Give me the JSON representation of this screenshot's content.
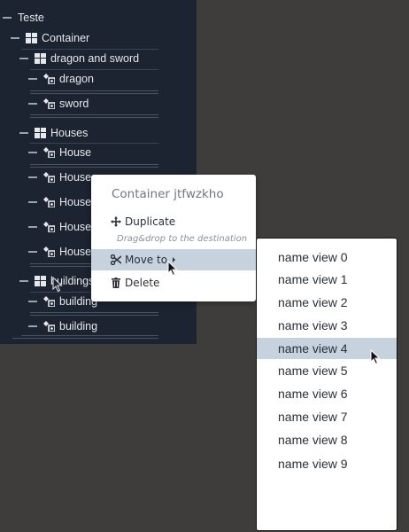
{
  "tree": {
    "nodes": [
      {
        "label": "Teste",
        "icon": "none"
      },
      {
        "label": "Container",
        "icon": "grid-icon"
      },
      {
        "label": "dragon and sword",
        "icon": "grid-icon"
      },
      {
        "label": "dragon",
        "icon": "shapes-icon"
      },
      {
        "label": "sword",
        "icon": "shapes-icon"
      },
      {
        "label": "Houses",
        "icon": "grid-icon"
      },
      {
        "label": "House",
        "icon": "shapes-icon"
      },
      {
        "label": "House",
        "icon": "shapes-icon"
      },
      {
        "label": "House",
        "icon": "shapes-icon"
      },
      {
        "label": "House",
        "icon": "shapes-icon"
      },
      {
        "label": "House",
        "icon": "shapes-icon"
      },
      {
        "label": "buildings",
        "icon": "grid-icon"
      },
      {
        "label": "building",
        "icon": "shapes-icon"
      },
      {
        "label": "building",
        "icon": "shapes-icon"
      }
    ]
  },
  "context_menu": {
    "title": "Container jtfwzkho",
    "duplicate": "Duplicate",
    "hint": "Drag&drop to the destination",
    "move_to": "Move to",
    "delete": "Delete"
  },
  "submenu": {
    "items": [
      "name view 0",
      "name view 1",
      "name view 2",
      "name view 3",
      "name view 4",
      "name view 5",
      "name view 6",
      "name view 7",
      "name view 8",
      "name view 9"
    ],
    "highlighted_index": 4
  },
  "colors": {
    "panel_bg": "#1c2331",
    "page_bg": "#3f3d3b",
    "highlight": "#c7d2df"
  }
}
